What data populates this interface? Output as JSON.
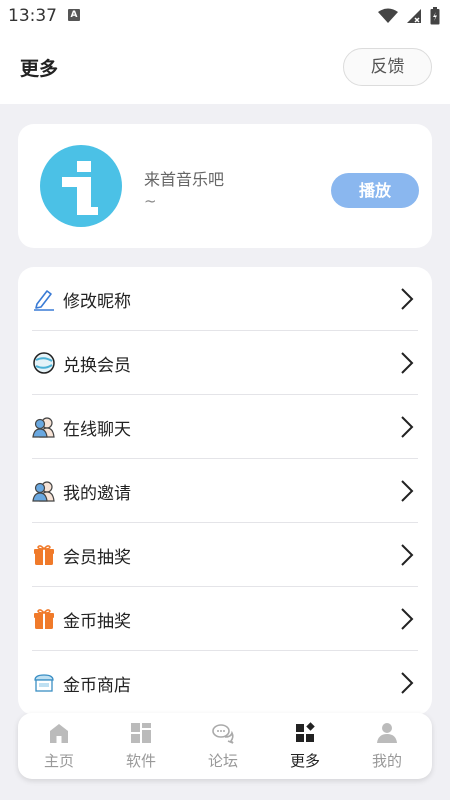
{
  "status_bar": {
    "time": "13:37",
    "notification_letter": "A"
  },
  "header": {
    "title": "更多",
    "feedback_label": "反馈"
  },
  "profile": {
    "name": "来首音乐吧",
    "subtitle": "~",
    "play_label": "播放"
  },
  "menu": {
    "items": [
      {
        "label": "修改昵称",
        "icon": "edit-icon"
      },
      {
        "label": "兑换会员",
        "icon": "planet-icon"
      },
      {
        "label": "在线聊天",
        "icon": "users-icon"
      },
      {
        "label": "我的邀请",
        "icon": "users-icon"
      },
      {
        "label": "会员抽奖",
        "icon": "gift-icon"
      },
      {
        "label": "金币抽奖",
        "icon": "gift-icon"
      },
      {
        "label": "金币商店",
        "icon": "shop-icon"
      }
    ]
  },
  "tabs": [
    {
      "label": "主页",
      "icon": "home-icon",
      "active": false
    },
    {
      "label": "软件",
      "icon": "apps-icon",
      "active": false
    },
    {
      "label": "论坛",
      "icon": "chat-icon",
      "active": false
    },
    {
      "label": "更多",
      "icon": "more-icon",
      "active": true
    },
    {
      "label": "我的",
      "icon": "user-icon",
      "active": false
    }
  ],
  "colors": {
    "accent_play": "#8ab7ef",
    "avatar_bg": "#4bc1e6",
    "gift_orange": "#f07a2a",
    "background": "#f0f0f4"
  }
}
